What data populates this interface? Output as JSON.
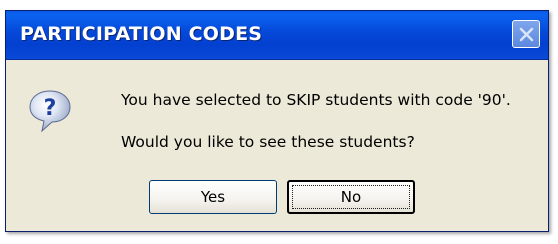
{
  "dialog": {
    "title": "PARTICIPATION CODES",
    "message_line1": "You have selected to SKIP students with code '90'.",
    "message_line2": "Would you like to see these students?",
    "icon": "question-icon",
    "close_icon": "close-icon",
    "buttons": {
      "yes_label": "Yes",
      "no_label": "No"
    },
    "colors": {
      "titlebar": "#0548d8",
      "body": "#ece9d8",
      "title_text": "#ffffff"
    }
  }
}
